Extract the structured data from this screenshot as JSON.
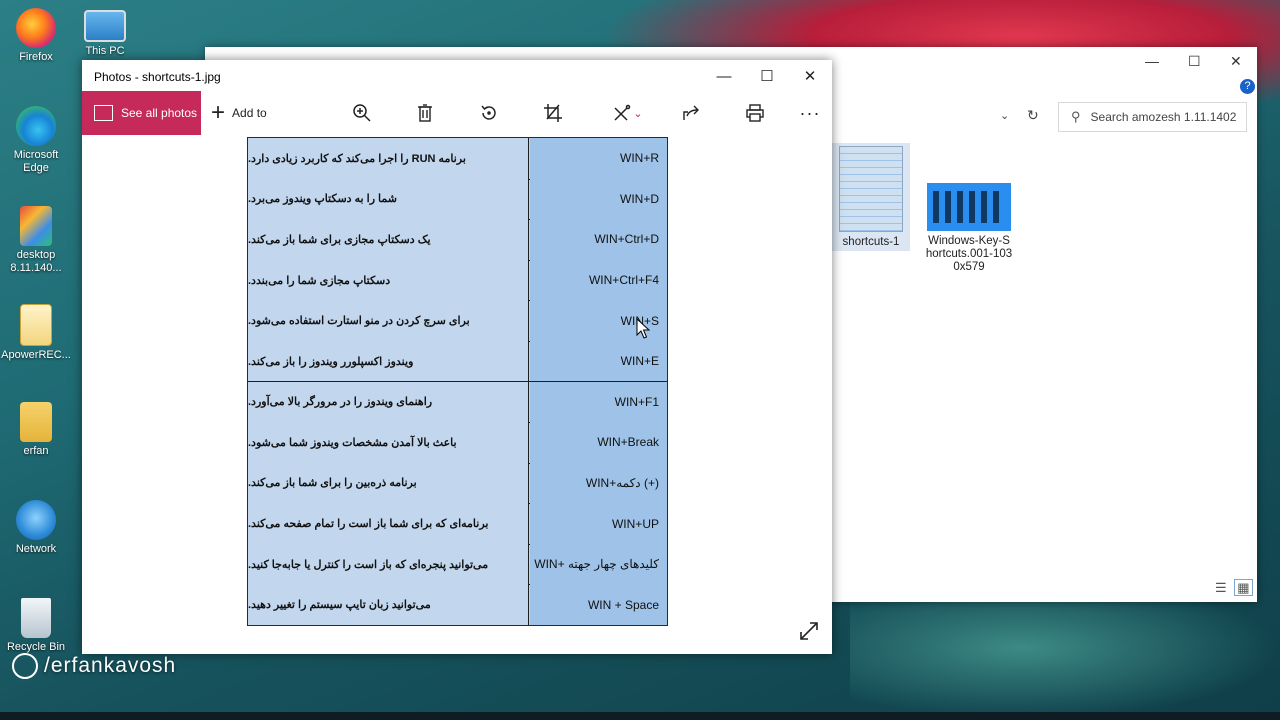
{
  "desktop": {
    "icons": [
      {
        "label": "Firefox",
        "x": 0
      },
      {
        "label": "Microsoft Edge"
      },
      {
        "label": "desktop 8.11.140..."
      },
      {
        "label": "ApowerREC..."
      },
      {
        "label": "erfan"
      },
      {
        "label": "Network"
      },
      {
        "label": "Recycle Bin"
      },
      {
        "label": "This PC"
      }
    ],
    "watermark": "/erfankavosh"
  },
  "explorer": {
    "search_placeholder": "Search amozesh 1.11.1402",
    "files": [
      {
        "name": "shortcuts-1"
      },
      {
        "name": "Windows-Key-Shortcuts.001-1030x579"
      }
    ]
  },
  "photos": {
    "title": "Photos - shortcuts-1.jpg",
    "see_all": "See all photos",
    "add_to": "Add to",
    "table": [
      {
        "key": "WIN+R",
        "desc": "برنامه RUN را اجرا می‌کند که کاربرد زیادی دارد."
      },
      {
        "key": "WIN+D",
        "desc": "شما را به دسکتاپ ویندوز می‌برد."
      },
      {
        "key": "WIN+Ctrl+D",
        "desc": "یک دسکتاپ مجازی برای شما باز می‌کند."
      },
      {
        "key": "WIN+Ctrl+F4",
        "desc": "دسکتاپ مجازی شما را می‌بندد."
      },
      {
        "key": "WIN+S",
        "desc": "برای سرچ کردن در منو استارت استفاده می‌شود."
      },
      {
        "key": "WIN+E",
        "desc": "ویندوز اکسپلورر ویندوز را باز می‌کند."
      },
      {
        "key": "WIN+F1",
        "desc": "راهنمای ویندوز را در مرورگر بالا می‌آورد."
      },
      {
        "key": "WIN+Break",
        "desc": "باعث بالا آمدن مشخصات ویندوز شما می‌شود."
      },
      {
        "key": "WIN+دکمه (+)",
        "desc": "برنامه ذره‌بین را برای شما باز می‌کند."
      },
      {
        "key": "WIN+UP",
        "desc": "برنامه‌ای که برای شما باز است را تمام صفحه می‌کند."
      },
      {
        "key": "WIN+ کلیدهای چهار جهته",
        "desc": "می‌توانید پنجره‌ای که باز است را کنترل یا جابه‌جا کنید."
      },
      {
        "key": "WIN + Space",
        "desc": "می‌توانید زبان تایپ سیستم را تغییر دهید."
      }
    ]
  },
  "colors": {
    "accent": "#c62a5a",
    "table_key_bg": "#9fc3e8",
    "table_desc_bg": "#c2d7ee"
  }
}
